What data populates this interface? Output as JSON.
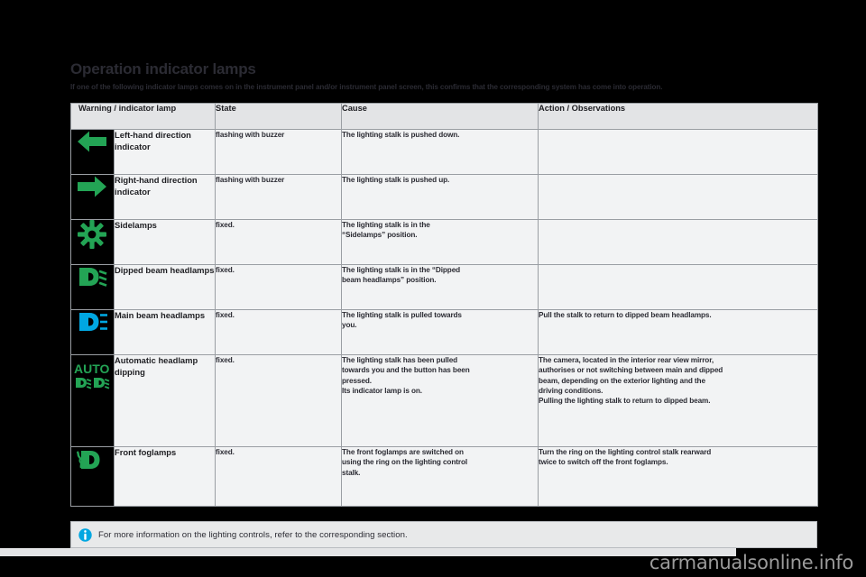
{
  "page": {
    "title": "Operation indicator lamps",
    "subtitle": "If one of the following indicator lamps comes on in the instrument panel and/or instrument panel screen, this confirms that the corresponding system has come into operation.",
    "watermark": "carmanualsonline.info"
  },
  "colors": {
    "green": "#23a455",
    "cyan": "#00a7e1",
    "icon_background": "#000000",
    "table_background": "#f2f3f4",
    "header_background": "#e3e4e6",
    "border": "#9a9ea3",
    "text": "#2b2b33",
    "note_background": "#e8e9ea"
  },
  "table": {
    "headers": [
      "Warning / indicator lamp",
      "State",
      "Cause",
      "Action / Observations"
    ],
    "rows": [
      {
        "icon": "left-arrow-icon",
        "lamp": "Left-hand direction indicator",
        "state": "flashing with buzzer",
        "cause": [
          "The lighting stalk is pushed down."
        ],
        "action": []
      },
      {
        "icon": "right-arrow-icon",
        "lamp": "Right-hand direction indicator",
        "state": "flashing with buzzer",
        "cause": [
          "The lighting stalk is pushed up."
        ],
        "action": []
      },
      {
        "icon": "sidelamps-icon",
        "lamp": "Sidelamps",
        "state": "fixed.",
        "cause": [
          "The lighting stalk is in the",
          "“Sidelamps” position."
        ],
        "action": []
      },
      {
        "icon": "dipped-beam-headlamps-icon",
        "lamp": "Dipped beam headlamps",
        "state": "fixed.",
        "cause": [
          "The lighting stalk is in the “Dipped",
          "beam headlamps” position."
        ],
        "action": []
      },
      {
        "icon": "main-beam-headlamps-icon",
        "lamp": "Main beam headlamps",
        "state": "fixed.",
        "cause": [
          "The lighting stalk is pulled towards",
          "you."
        ],
        "action": [
          "Pull the stalk to return to dipped beam headlamps."
        ]
      },
      {
        "icon": "automatic-headlamp-dipping-icon",
        "lamp": "Automatic headlamp dipping",
        "state": "fixed.",
        "cause": [
          "The lighting stalk has been pulled",
          "towards you and the button has been",
          "pressed.",
          "Its indicator lamp is on."
        ],
        "action": [
          "The camera, located in the interior rear view mirror,",
          "authorises or not switching between main and dipped",
          "beam, depending on the exterior lighting and the",
          "driving conditions.",
          "Pulling the lighting stalk to return to dipped beam."
        ]
      },
      {
        "icon": "front-foglamps-icon",
        "lamp": "Front foglamps",
        "state": "fixed.",
        "cause": [
          "The front foglamps are switched on",
          "using the ring on the lighting control",
          "stalk."
        ],
        "action": [
          "Turn the ring on the lighting control stalk rearward",
          "twice to switch off the front foglamps."
        ]
      }
    ]
  },
  "note": {
    "icon": "info-icon",
    "text": "For more information on the lighting controls, refer to the corresponding section."
  }
}
